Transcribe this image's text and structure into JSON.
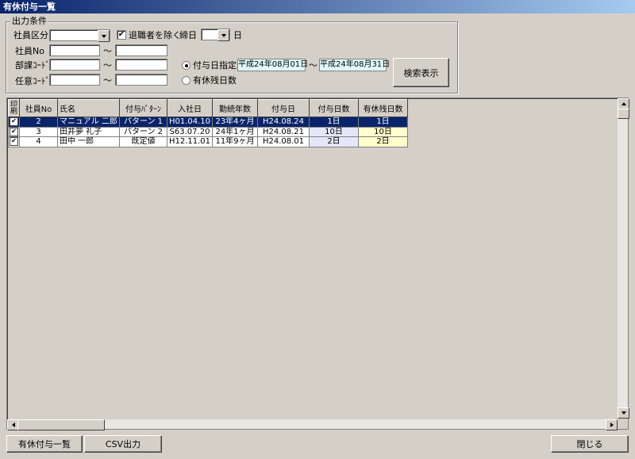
{
  "window": {
    "title": "有休付与一覧"
  },
  "filter": {
    "group_title": "出力条件",
    "employee_type_label": "社員区分",
    "employee_type_value": "",
    "exclude_retired_label": "退職者を除く",
    "exclude_retired_checked": true,
    "closing_day_label": "締日",
    "closing_day_value": "",
    "closing_day_unit": "日",
    "employee_no_label": "社員No",
    "dept_code_label": "部課ｺｰﾄﾞ",
    "optional_code_label": "任意ｺｰﾄﾞ",
    "tilde": "～",
    "grant_date_label": "付与日指定",
    "grant_date_from": "平成24年08月01日",
    "grant_date_to": "平成24年08月31日",
    "remaining_days_label": "有休残日数",
    "search_button": "検索表示"
  },
  "grid": {
    "headers": [
      "印刷",
      "社員No",
      "氏名",
      "付与ﾊﾟﾀｰﾝ",
      "入社日",
      "勤続年数",
      "付与日",
      "付与日数",
      "有休残日数"
    ],
    "rows": [
      {
        "print": true,
        "no": "2",
        "name": "マニュアル 二郎",
        "pattern": "パターン 1",
        "hire": "H01.04.10",
        "tenure": "23年4ヶ月",
        "grant": "H24.08.24",
        "days": "1日",
        "remain": "1日"
      },
      {
        "print": true,
        "no": "3",
        "name": "田井夢 礼子",
        "pattern": "パターン 2",
        "hire": "S63.07.20",
        "tenure": "24年1ヶ月",
        "grant": "H24.08.21",
        "days": "10日",
        "remain": "10日"
      },
      {
        "print": true,
        "no": "4",
        "name": "田中 一郎",
        "pattern": "既定値",
        "hire": "H12.11.01",
        "tenure": "11年9ヶ月",
        "grant": "H24.08.01",
        "days": "2日",
        "remain": "2日"
      }
    ]
  },
  "footer": {
    "print_button": "有休付与一覧",
    "csv_button": "CSV出力",
    "close_button": "閉じる"
  }
}
